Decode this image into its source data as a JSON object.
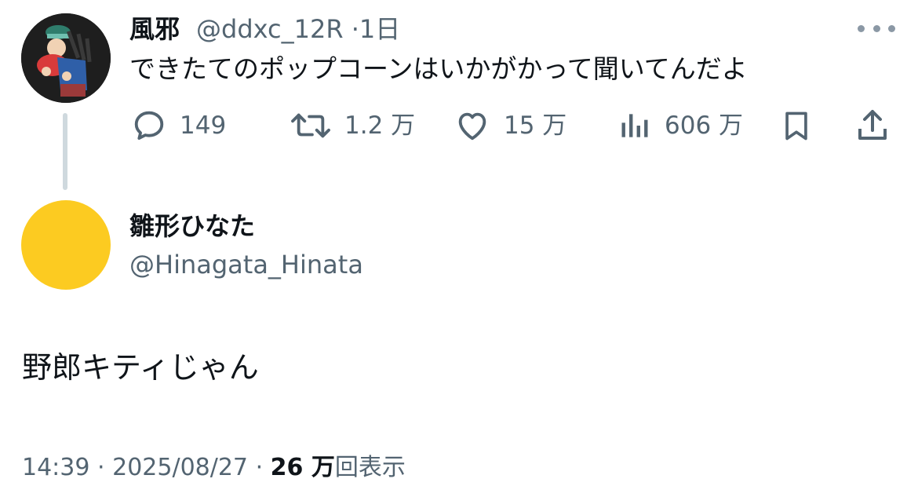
{
  "tweet": {
    "author_name": "風邪",
    "author_handle": "@ddxc_12R",
    "separator": "·",
    "time_ago": "1日",
    "text": "できたてのポップコーンはいかがかって聞いてんだよ",
    "actions": {
      "reply_count": "149",
      "retweet_count": "1.2 万",
      "like_count": "15 万",
      "view_count": "606 万"
    }
  },
  "reply": {
    "author_name": "雛形ひなた",
    "author_handle": "@Hinagata_Hinata",
    "avatar_color": "#fccb21",
    "text": "野郎キティじゃん",
    "time": "14:39",
    "separator": "·",
    "date": "2025/08/27",
    "views_number": "26",
    "views_unit": "万",
    "views_label": "回表示"
  },
  "icons": {
    "reply": "reply-icon",
    "retweet": "retweet-icon",
    "like": "heart-icon",
    "views": "views-icon",
    "bookmark": "bookmark-icon",
    "share": "share-icon",
    "more": "more-icon"
  }
}
